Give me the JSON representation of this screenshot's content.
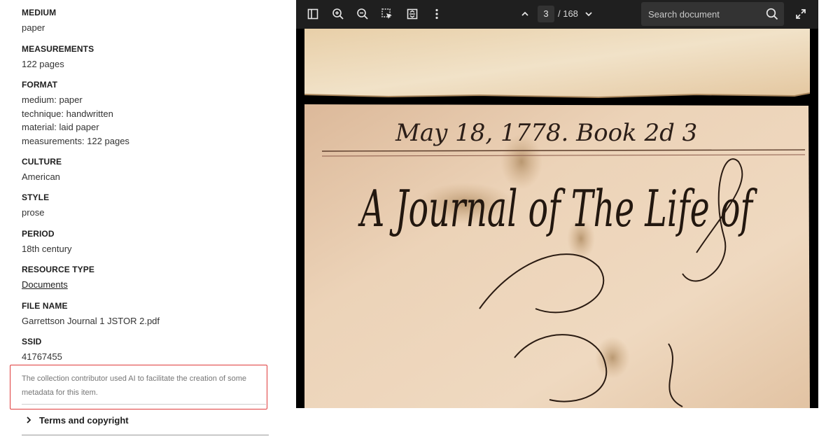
{
  "metadata": {
    "fields": [
      {
        "label": "MEDIUM",
        "values": [
          "paper"
        ]
      },
      {
        "label": "MEASUREMENTS",
        "values": [
          "122 pages"
        ]
      },
      {
        "label": "FORMAT",
        "values": [
          "medium: paper",
          "technique: handwritten",
          "material: laid paper",
          "measurements: 122 pages"
        ]
      },
      {
        "label": "CULTURE",
        "values": [
          "American"
        ]
      },
      {
        "label": "STYLE",
        "values": [
          "prose"
        ]
      },
      {
        "label": "PERIOD",
        "values": [
          "18th century"
        ]
      },
      {
        "label": "RESOURCE TYPE",
        "values": [
          "Documents"
        ],
        "link": true
      },
      {
        "label": "FILE NAME",
        "values": [
          "Garrettson Journal 1 JSTOR 2.pdf"
        ]
      },
      {
        "label": "SSID",
        "values": [
          "41767455"
        ]
      }
    ],
    "ai_note": "The collection contributor used AI to facilitate the creation of some metadata for this item.",
    "terms_label": "Terms and copyright"
  },
  "viewer": {
    "current_page": "3",
    "page_total": "/ 168",
    "search_placeholder": "Search document",
    "icons": [
      "sidebar-toggle-icon",
      "zoom-in-icon",
      "zoom-out-icon",
      "selection-tool-icon",
      "fit-page-icon",
      "more-options-icon",
      "chevron-up-icon",
      "chevron-down-icon",
      "search-icon",
      "fullscreen-icon"
    ],
    "handwriting_header": "May 18, 1778. Book 2d 3",
    "handwriting_title": "A Journal of The Life of"
  },
  "colors": {
    "toolbar_bg": "#1f1f1f",
    "highlight_border": "#e03b3b",
    "paper": "#e9cdb0"
  }
}
